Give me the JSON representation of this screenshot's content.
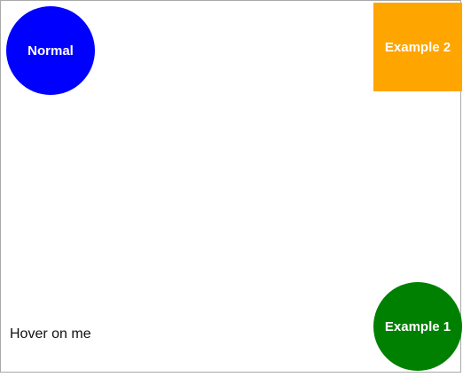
{
  "shapes": {
    "normal": {
      "label": "Normal",
      "color": "#0000ff",
      "shape": "circle"
    },
    "example2": {
      "label": "Example 2",
      "color": "#ffa500",
      "shape": "square"
    },
    "example1": {
      "label": "Example 1",
      "color": "#008000",
      "shape": "circle"
    }
  },
  "hover_text": "Hover on me"
}
